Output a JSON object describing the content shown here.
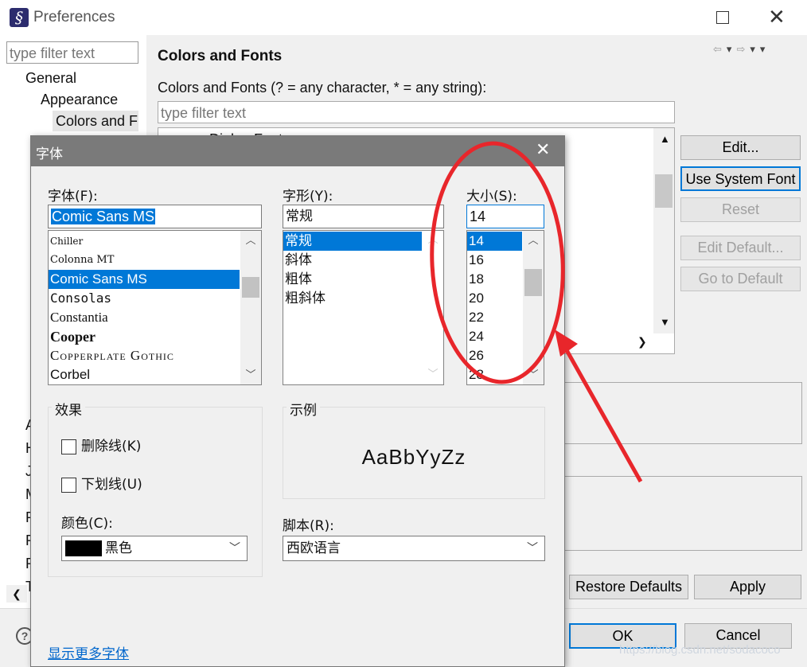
{
  "window": {
    "title": "Preferences",
    "filter_placeholder": "type filter text"
  },
  "tree": {
    "items": [
      "General",
      "Appearance",
      "Colors and F"
    ],
    "partial_letters": [
      "A",
      "H",
      "J",
      "M",
      "P",
      "R",
      "R",
      "T"
    ]
  },
  "page": {
    "heading": "Colors and Fonts",
    "instruction": "Colors and Fonts (? = any character, * = any string):",
    "filter_placeholder": "type filter text",
    "partial_item": "Dialog Font"
  },
  "side_buttons": {
    "edit": "Edit...",
    "use_system_font": "Use System Font",
    "reset": "Reset",
    "edit_default": "Edit Default...",
    "go_to_default": "Go to Default"
  },
  "bottom_buttons": {
    "restore_defaults": "Restore Defaults",
    "apply": "Apply",
    "ok": "OK",
    "cancel": "Cancel"
  },
  "font_dialog": {
    "title": "字体",
    "font_label": "字体(F):",
    "font_value": "Comic Sans MS",
    "fonts": [
      "Chiller",
      "Colonna MT",
      "Comic Sans MS",
      "Consolas",
      "Constantia",
      "Cooper",
      "Copperplate Gothic",
      "Corbel"
    ],
    "style_label": "字形(Y):",
    "style_value": "常规",
    "styles": [
      "常规",
      "斜体",
      "粗体",
      "粗斜体"
    ],
    "size_label": "大小(S):",
    "size_value": "14",
    "sizes": [
      "14",
      "16",
      "18",
      "20",
      "22",
      "24",
      "26",
      "28"
    ],
    "effects_title": "效果",
    "strikeout": "删除线(K)",
    "underline": "下划线(U)",
    "color_label": "颜色(C):",
    "color_value": "黑色",
    "color_swatch": "#000000",
    "sample_title": "示例",
    "sample_text": "AaBbYyZz",
    "script_label": "脚本(R):",
    "script_value": "西欧语言",
    "more_fonts_link": "显示更多字体"
  },
  "watermark": "https://blog.csdn.net/sodacoco",
  "colors": {
    "selection": "#0078d7",
    "annotation": "#e8262b",
    "dialog_title_bar": "#7a7a7a",
    "link": "#0066cc"
  }
}
